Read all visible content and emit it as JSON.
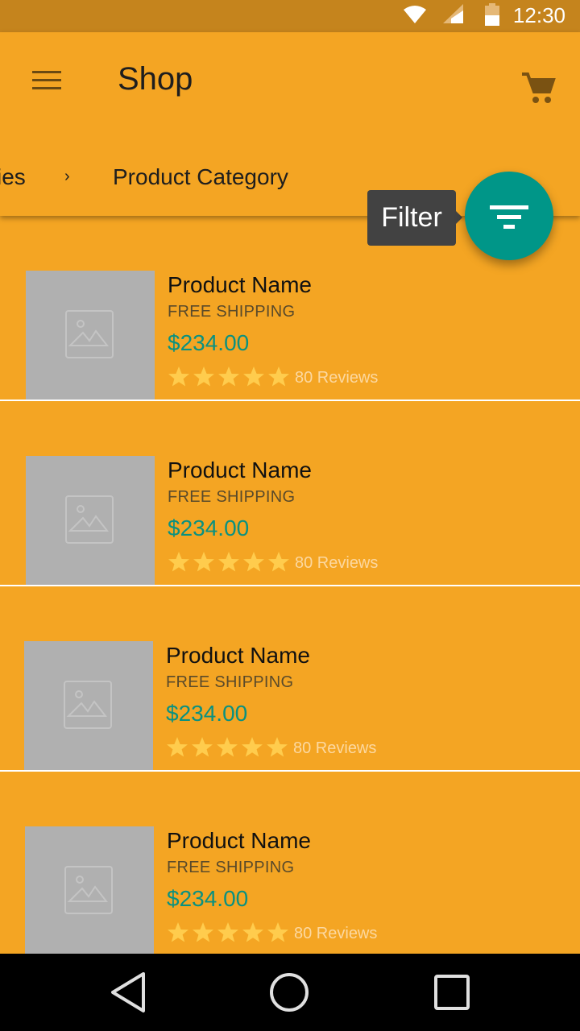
{
  "status_bar": {
    "time": "12:30",
    "icons": [
      "wifi-icon",
      "cell-signal-icon",
      "battery-icon"
    ]
  },
  "app_bar": {
    "title": "Shop",
    "menu_icon": "menu-icon",
    "cart_icon": "cart-icon"
  },
  "breadcrumb": {
    "previous": "ies",
    "separator": "›",
    "current": "Product Category"
  },
  "filter": {
    "tooltip": "Filter",
    "icon": "filter-icon",
    "color": "#009688"
  },
  "products": [
    {
      "name": "Product Name",
      "shipping": "FREE SHIPPING",
      "price": "$234.00",
      "rating": 5,
      "reviews": "80 Reviews"
    },
    {
      "name": "Product Name",
      "shipping": "FREE SHIPPING",
      "price": "$234.00",
      "rating": 5,
      "reviews": "80 Reviews"
    },
    {
      "name": "Product Name",
      "shipping": "FREE SHIPPING",
      "price": "$234.00",
      "rating": 5,
      "reviews": "80 Reviews"
    },
    {
      "name": "Product Name",
      "shipping": "FREE SHIPPING",
      "price": "$234.00",
      "rating": 5,
      "reviews": "80 Reviews"
    }
  ],
  "colors": {
    "primary": "#F4A523",
    "status_bar": "#C5841D",
    "accent": "#009688",
    "price": "#0A9180",
    "star": "#FFCC4D"
  },
  "nav_bar": {
    "icons": [
      "back-icon",
      "home-icon",
      "recents-icon"
    ]
  }
}
